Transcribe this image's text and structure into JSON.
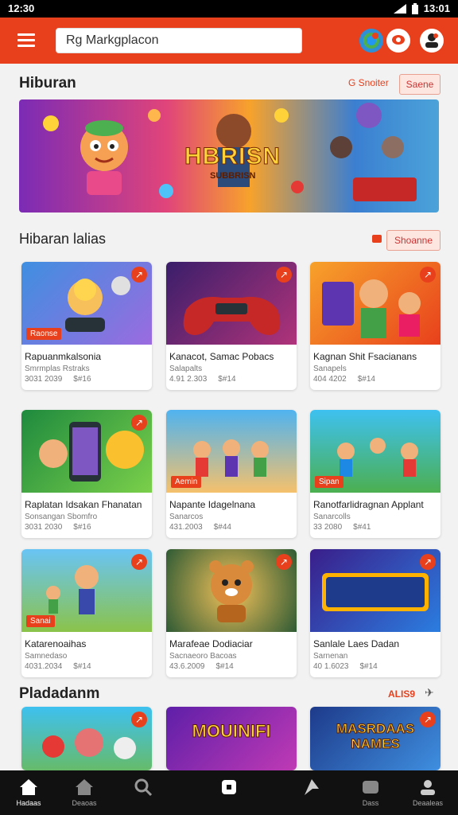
{
  "statusbar": {
    "time": "12:30",
    "right_time": "13:01"
  },
  "appbar": {
    "search_value": "Rg Markgplacon",
    "colors": {
      "primary": "#e8401c"
    }
  },
  "section1": {
    "title": "Hiburan",
    "link": "G Snoiter",
    "pill": "Saene"
  },
  "banner": {
    "title": "HBRISN",
    "subtitle": "SUBBRISN"
  },
  "section2": {
    "title": "Hibaran lalias",
    "pill": "Shoanne"
  },
  "cards": [
    {
      "name": "Rapuanmkalsonia",
      "meta1": "Smrmplas Rstraks",
      "meta2a": "3031 2039",
      "meta2b": "$#16",
      "badge": "Raonse"
    },
    {
      "name": "Kanacot, Samac Pobacs",
      "meta1": "Salapalts",
      "meta2a": "4.91 2.303",
      "meta2b": "$#14",
      "badge": ""
    },
    {
      "name": "Kagnan Shit Fsacianans",
      "meta1": "Sanapels",
      "meta2a": "404 4202",
      "meta2b": "$#14",
      "badge": ""
    },
    {
      "name": "Raplatan Idsakan Fhanatan",
      "meta1": "Sonsangan Sbomfro",
      "meta2a": "3031 2030",
      "meta2b": "$#16",
      "badge": ""
    },
    {
      "name": "Napante Idagelnana",
      "meta1": "Sanarcos",
      "meta2a": "431.2003",
      "meta2b": "$#44",
      "badge": "Aemin"
    },
    {
      "name": "Ranotfarlidragnan Applant",
      "meta1": "Sanarcolls",
      "meta2a": "33 2080",
      "meta2b": "$#41",
      "badge": "Sipan"
    },
    {
      "name": "Katarenoaihas",
      "meta1": "Samnedaso",
      "meta2a": "4031.2034",
      "meta2b": "$#14",
      "badge": "Sanai"
    },
    {
      "name": "Marafeae Dodiaciar",
      "meta1": "Sacnaeoro Bacoas",
      "meta2a": "43.6.2009",
      "meta2b": "$#14",
      "badge": ""
    },
    {
      "name": "Sanlale Laes Dadan",
      "meta1": "Sarnenan",
      "meta2a": "40 1.6023",
      "meta2b": "$#14",
      "badge": ""
    }
  ],
  "section3": {
    "title": "Pladadanm",
    "link": "ALIS9"
  },
  "bottom_cards": [
    {
      "title": "",
      "badge": ""
    },
    {
      "title": "MOUINIFI",
      "badge": ""
    },
    {
      "title": "MASRDAAS NAMES",
      "badge": ""
    }
  ],
  "navbar": [
    {
      "label": "Hadaas",
      "icon": "home-icon"
    },
    {
      "label": "Deaoas",
      "icon": "store-icon"
    },
    {
      "label": "",
      "icon": "search-icon"
    },
    {
      "label": "",
      "icon": "square-icon"
    },
    {
      "label": "",
      "icon": "share-icon"
    },
    {
      "label": "Dass",
      "icon": "gamepad-icon"
    },
    {
      "label": "Deaaleas",
      "icon": "profile-icon"
    }
  ]
}
